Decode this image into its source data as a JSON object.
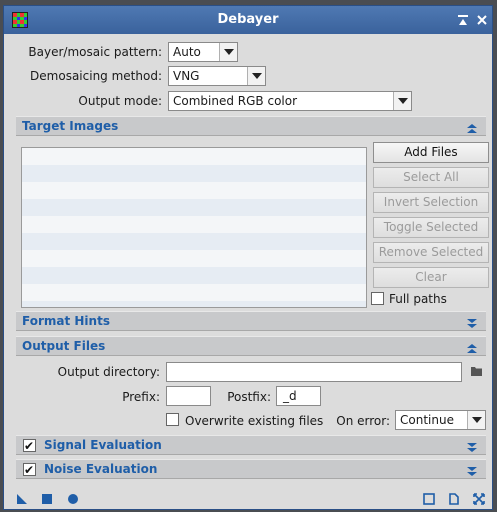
{
  "window": {
    "title": "Debayer"
  },
  "bayer": {
    "label": "Bayer/mosaic pattern:",
    "value": "Auto"
  },
  "demosaic": {
    "label": "Demosaicing method:",
    "value": "VNG"
  },
  "output_mode": {
    "label": "Output mode:",
    "value": "Combined RGB color"
  },
  "target_images": {
    "title": "Target Images",
    "buttons": {
      "add_files": "Add Files",
      "select_all": "Select All",
      "invert_selection": "Invert Selection",
      "toggle_selected": "Toggle Selected",
      "remove_selected": "Remove Selected",
      "clear": "Clear"
    },
    "full_paths": "Full paths"
  },
  "format_hints": {
    "title": "Format Hints"
  },
  "output_files": {
    "title": "Output Files",
    "output_directory_label": "Output directory:",
    "output_directory_value": "",
    "prefix_label": "Prefix:",
    "prefix_value": "",
    "postfix_label": "Postfix:",
    "postfix_value": "_d",
    "overwrite_label": "Overwrite existing files",
    "on_error_label": "On error:",
    "on_error_value": "Continue"
  },
  "signal_evaluation": {
    "title": "Signal Evaluation",
    "checked": true
  },
  "noise_evaluation": {
    "title": "Noise Evaluation",
    "checked": true
  },
  "colors": {
    "titlebar": "#3f69a4",
    "section_text": "#1f5ea8",
    "accent": "#1f5ea8"
  },
  "icons": [
    "app-icon",
    "shade-icon",
    "close-icon",
    "collapse-icon",
    "expand-icon",
    "folder-icon",
    "new-instance-icon",
    "apply-global-icon",
    "apply-icon",
    "preview-icon",
    "documentation-icon",
    "reset-icon"
  ]
}
